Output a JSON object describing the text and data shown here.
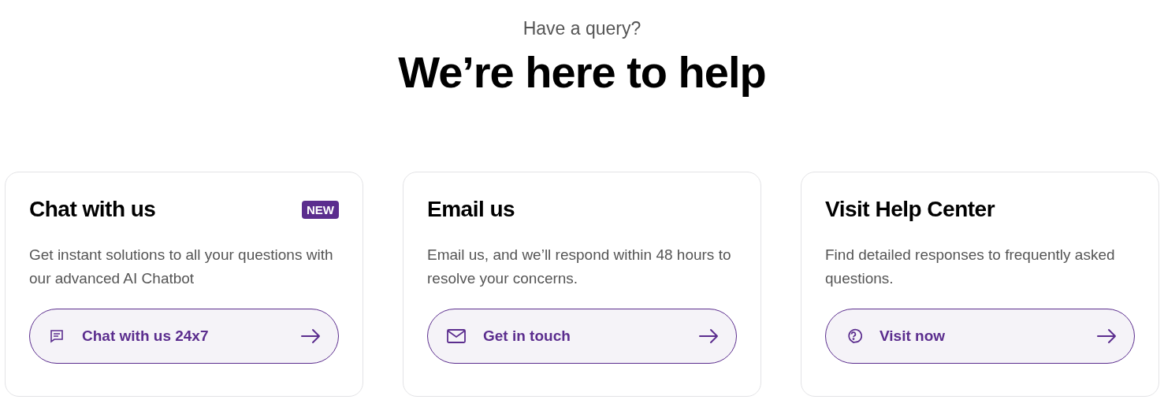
{
  "eyebrow": "Have a query?",
  "heading": "We’re here to help",
  "cards": [
    {
      "kind": "chat",
      "title": "Chat with us",
      "badge": "NEW",
      "description": "Get instant solutions to all your questions with our advanced AI Chatbot",
      "button": "Chat with us 24x7"
    },
    {
      "kind": "email",
      "title": "Email us",
      "description": "Email us, and we’ll respond within 48 hours to resolve your concerns.",
      "button": "Get in touch"
    },
    {
      "kind": "help",
      "title": "Visit Help Center",
      "description": "Find detailed responses to frequently asked questions.",
      "button": "Visit now"
    }
  ]
}
